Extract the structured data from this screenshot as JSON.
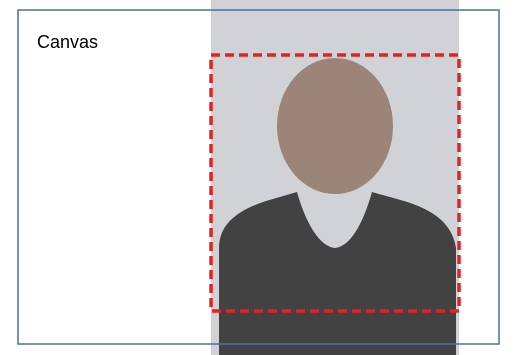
{
  "canvas": {
    "label": "Canvas",
    "border_color": "#4a6fa5"
  },
  "photo": {
    "background_color": "#d0d2d5",
    "head_color": "#9b8478",
    "body_color": "#424242"
  },
  "crop_box": {
    "stroke_color": "#e82020",
    "style": "dashed"
  }
}
